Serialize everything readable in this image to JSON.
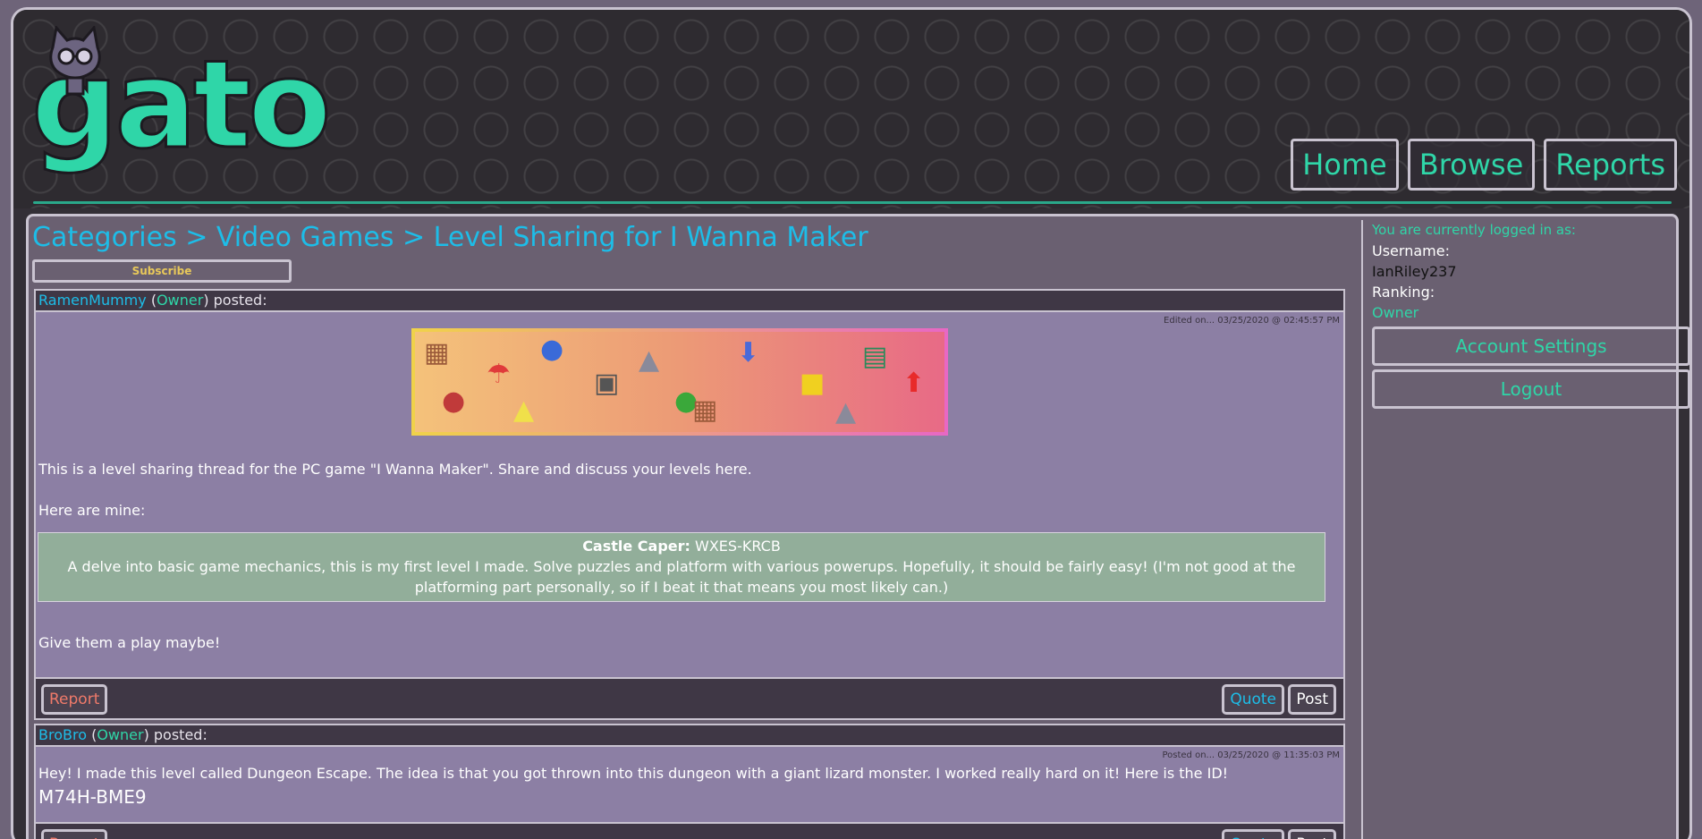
{
  "header": {
    "logo_text": "gato",
    "nav": [
      {
        "label": "Home"
      },
      {
        "label": "Browse"
      },
      {
        "label": "Reports"
      }
    ]
  },
  "breadcrumb": "Categories > Video Games > Level Sharing for I Wanna Maker",
  "subscribe_label": "Subscribe",
  "posts": [
    {
      "user": "RamenMummy",
      "rank": "Owner",
      "posted_suffix": ") posted:",
      "stamp": "Edited on... 03/25/2020 @ 02:45:57 PM",
      "intro": "This is a level sharing thread for the PC game \"I Wanna Maker\". Share and discuss your levels here.",
      "mine": "Here are mine:",
      "level_name": "Castle Caper:",
      "level_code": " WXES-KRCB",
      "level_desc": "A delve into basic game mechanics, this is my first level I made. Solve puzzles and platform with various powerups. Hopefully, it should be fairly easy! (I'm not good at the platforming part personally, so if I beat it that means you most likely can.)",
      "closing": "Give them a play maybe!",
      "report_label": "Report",
      "quote_label": "Quote",
      "post_label": "Post"
    },
    {
      "user": "BroBro",
      "rank": "Owner",
      "posted_suffix": ") posted:",
      "stamp": "Posted on... 03/25/2020 @ 11:35:03 PM",
      "body": "Hey! I made this level called Dungeon Escape. The idea is that you got thrown into this dungeon with a giant lizard monster. I worked really hard on it! Here is the ID!",
      "code": "M74H-BME9",
      "report_label": "Report",
      "quote_label": "Quote",
      "post_label": "Post"
    }
  ],
  "sidebar": {
    "logged_in": "You are currently logged in as:",
    "username_label": "Username:",
    "username": "IanRiley237",
    "ranking_label": "Ranking:",
    "ranking": "Owner",
    "account_settings": "Account Settings",
    "logout": "Logout"
  },
  "colors": {
    "accent_teal": "#2fd6a8",
    "link_blue": "#1dbde8",
    "report_red": "#f07a6a",
    "subscribe_yellow": "#e8c85a"
  }
}
